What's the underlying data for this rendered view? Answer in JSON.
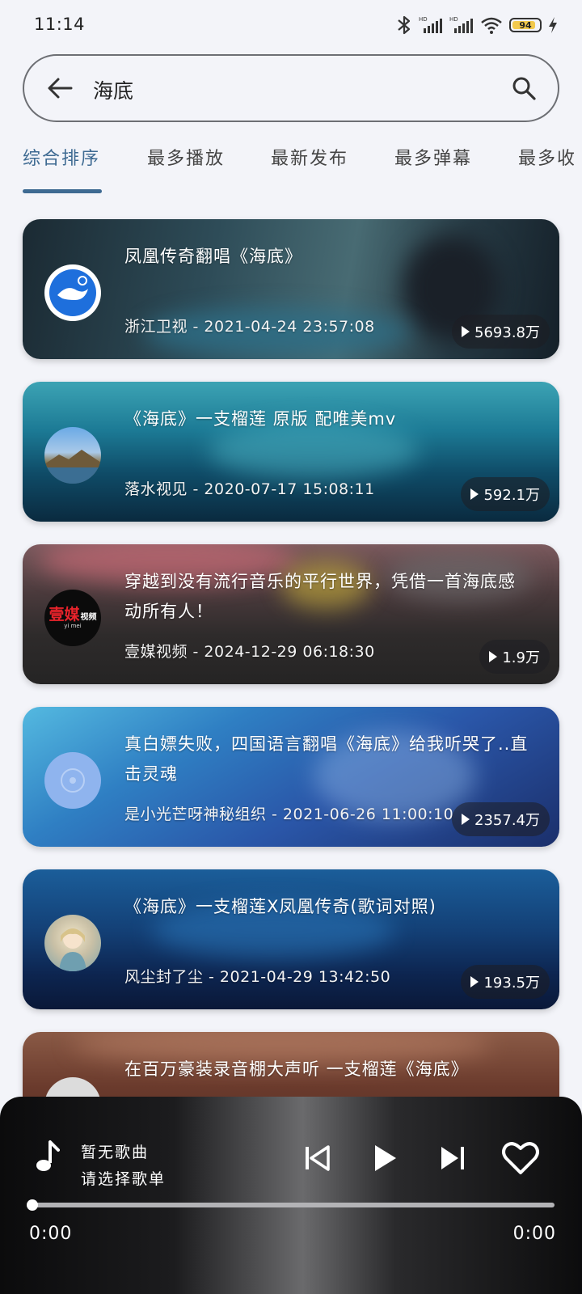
{
  "status_bar": {
    "time": "11:14",
    "battery": "94"
  },
  "search": {
    "query": "海底"
  },
  "tabs": [
    {
      "label": "综合排序",
      "active": true
    },
    {
      "label": "最多播放",
      "active": false
    },
    {
      "label": "最新发布",
      "active": false
    },
    {
      "label": "最多弹幕",
      "active": false
    },
    {
      "label": "最多收",
      "active": false
    }
  ],
  "results": [
    {
      "title": "凤凰传奇翻唱《海底》",
      "meta": "浙江卫视 - 2021-04-24 23:57:08",
      "plays": "5693.8万"
    },
    {
      "title": "《海底》一支榴莲 原版 配唯美mv",
      "meta": "落水视见 - 2020-07-17 15:08:11",
      "plays": "592.1万"
    },
    {
      "title": "穿越到没有流行音乐的平行世界，凭借一首海底感动所有人！",
      "meta": "壹媒视频 - 2024-12-29 06:18:30",
      "plays": "1.9万",
      "avatar_text_main": "壹媒",
      "avatar_text_side": "视频",
      "avatar_text_sub": "yi mei"
    },
    {
      "title": "真白嫖失败，四国语言翻唱《海底》给我听哭了..直击灵魂",
      "meta": "是小光芒呀神秘组织 - 2021-06-26 11:00:10",
      "plays": "2357.4万"
    },
    {
      "title": "《海底》一支榴莲X凤凰传奇(歌词对照)",
      "meta": "风尘封了尘 - 2021-04-29 13:42:50",
      "plays": "193.5万"
    },
    {
      "title": "在百万豪装录音棚大声听 一支榴莲《海底》",
      "meta": "",
      "plays": ""
    }
  ],
  "player": {
    "title": "暂无歌曲",
    "subtitle": "请选择歌单",
    "current_time": "0:00",
    "total_time": "0:00",
    "progress": 0
  }
}
